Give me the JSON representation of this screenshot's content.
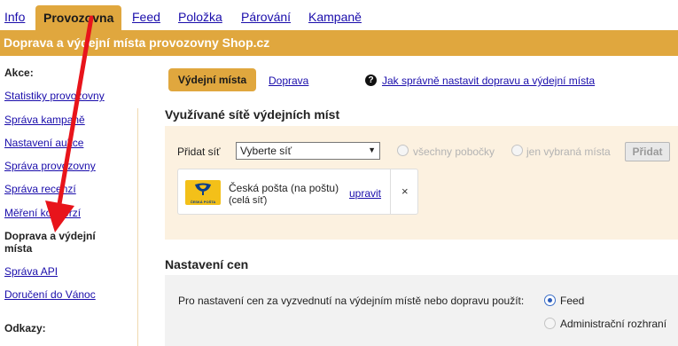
{
  "nav": {
    "tabs": [
      {
        "label": "Info"
      },
      {
        "label": "Provozovna",
        "active": true
      },
      {
        "label": "Feed"
      },
      {
        "label": "Položka"
      },
      {
        "label": "Párování"
      },
      {
        "label": "Kampaně"
      }
    ]
  },
  "page": {
    "title": "Doprava a výdejní místa provozovny Shop.cz"
  },
  "sidebar": {
    "actions_heading": "Akce:",
    "items": [
      {
        "label": "Statistiky provozovny"
      },
      {
        "label": "Správa kampaně"
      },
      {
        "label": "Nastavení aukce"
      },
      {
        "label": "Správa provozovny"
      },
      {
        "label": "Správa recenzí"
      },
      {
        "label": "Měření konverzí"
      },
      {
        "label": "Doprava a výdejní místa",
        "current": true
      },
      {
        "label": "Správa API"
      },
      {
        "label": "Doručení do Vánoc"
      }
    ],
    "links_heading": "Odkazy:"
  },
  "subtabs": {
    "active": "Výdejní místa",
    "other": "Doprava",
    "help_link": "Jak správně nastavit dopravu a výdejní místa"
  },
  "networks": {
    "title": "Využívané sítě výdejních míst",
    "add_label": "Přidat síť",
    "select_value": "Vyberte síť",
    "option_all": "všechny pobočky",
    "option_selected": "jen vybraná místa",
    "add_button": "Přidat",
    "card": {
      "name": "Česká pošta (na poštu)",
      "scope": "(celá síť)",
      "logo_text": "ČESKÁ POŠTA",
      "edit_label": "upravit",
      "close_label": "×"
    }
  },
  "prices": {
    "title": "Nastavení cen",
    "label": "Pro nastavení cen za vyzvednutí na výdejním místě nebo dopravu použít:",
    "options": [
      {
        "label": "Feed",
        "checked": true
      },
      {
        "label": "Administrační rozhraní",
        "checked": false
      }
    ]
  },
  "colors": {
    "accent": "#e0a73e",
    "link": "#1a0dab",
    "annotation_arrow": "#e8141b"
  }
}
